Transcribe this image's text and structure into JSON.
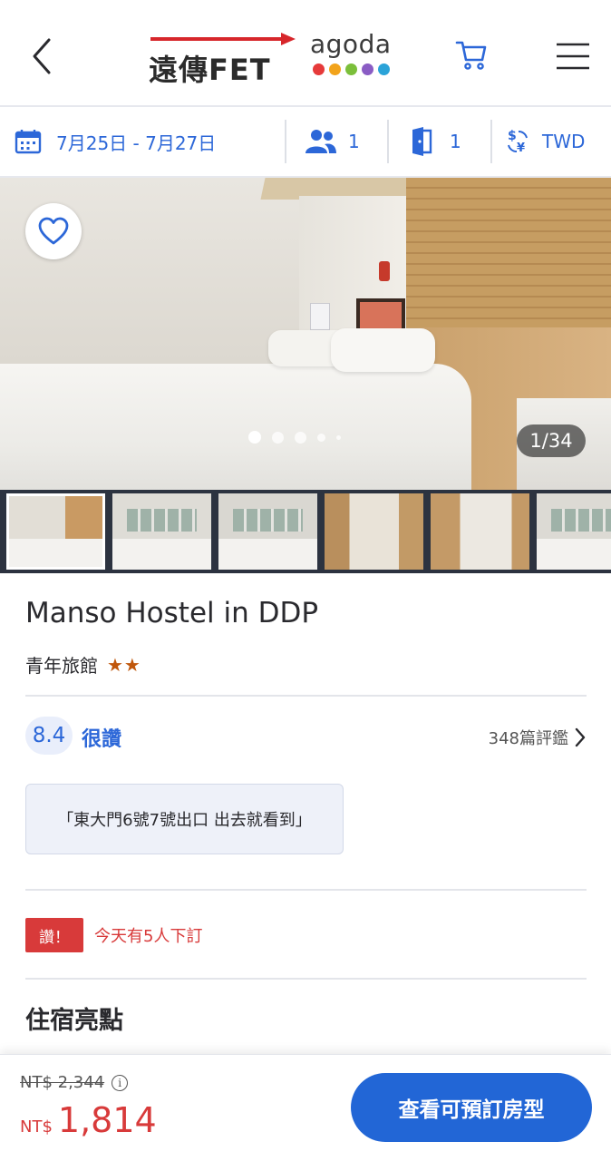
{
  "header": {
    "brand_fet": "遠傳FET",
    "brand_agoda": "agoda",
    "agoda_dot_colors": [
      "#e63a3a",
      "#f2a31b",
      "#7bbf3a",
      "#8a5cc4",
      "#2ba3d8"
    ]
  },
  "search": {
    "dates": "7月25日 - 7月27日",
    "guests": "1",
    "rooms": "1",
    "currency": "TWD"
  },
  "gallery": {
    "counter": "1/34",
    "thumbnail_count": 6
  },
  "hotel": {
    "name": "Manso Hostel in DDP",
    "type": "青年旅館",
    "stars": "★★",
    "score": "8.4",
    "score_label": "很讚",
    "reviews": "348篇評鑑",
    "quote": "「東大門6號7號出口 出去就看到」",
    "urgency_badge": "讚！",
    "urgency_text": "今天有5人下訂",
    "highlights_title": "住宿亮點"
  },
  "footer": {
    "original_price": "NT$ 2,344",
    "info_symbol": "i",
    "currency": "NT$",
    "price": "1,814",
    "cta": "查看可預訂房型"
  },
  "colors": {
    "brand_blue": "#2c67d8",
    "urgency_red": "#d83a3a",
    "star_orange": "#c0570c",
    "cta_blue": "#2266d6"
  }
}
